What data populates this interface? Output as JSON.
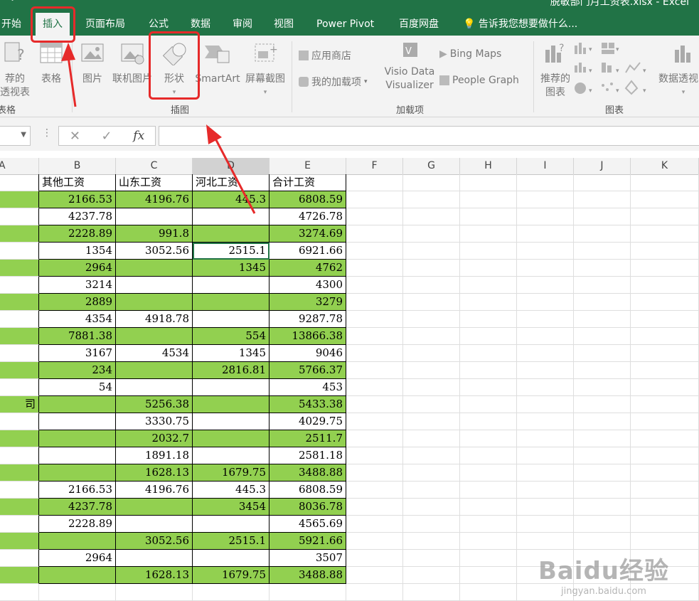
{
  "window": {
    "title": "脱敏部门月工资表.xlsx - Excel"
  },
  "tabs": [
    {
      "label": "开始",
      "active": false
    },
    {
      "label": "插入",
      "active": true
    },
    {
      "label": "页面布局",
      "active": false
    },
    {
      "label": "公式",
      "active": false
    },
    {
      "label": "数据",
      "active": false
    },
    {
      "label": "审阅",
      "active": false
    },
    {
      "label": "视图",
      "active": false
    },
    {
      "label": "Power Pivot",
      "active": false
    },
    {
      "label": "百度网盘",
      "active": false
    }
  ],
  "tell_me": "告诉我您想要做什么...",
  "ribbon": {
    "tables": {
      "pivot_line1": "荐的",
      "pivot_line2": "透视表",
      "table": "表格",
      "group": "表格"
    },
    "illustrations": {
      "picture": "图片",
      "online_picture": "联机图片",
      "shapes": "形状",
      "smartart": "SmartArt",
      "screenshot": "屏幕截图",
      "group": "插图"
    },
    "addins": {
      "store": "应用商店",
      "my_addins": "我的加载项",
      "visio_line1": "Visio Data",
      "visio_line2": "Visualizer",
      "bing": "Bing Maps",
      "people": "People Graph",
      "group": "加载项"
    },
    "charts": {
      "rec_line1": "推荐的",
      "rec_line2": "图表",
      "pivotchart": "数据透视图",
      "group": "图表"
    }
  },
  "formula_bar": {
    "name_box": "",
    "formula": "",
    "cancel_glyph": "✕",
    "enter_glyph": "✓",
    "fx_glyph": "fx"
  },
  "columns": [
    "A",
    "B",
    "C",
    "D",
    "E",
    "F",
    "G",
    "H",
    "I",
    "J",
    "K"
  ],
  "selected_column": "D",
  "header_row": {
    "a": "",
    "b": "其他工资",
    "c": "山东工资",
    "d": "河北工资",
    "e": "合计工资"
  },
  "rows": [
    {
      "a": "",
      "b": "2166.53",
      "c": "4196.76",
      "d": "445.3",
      "e": "6808.59",
      "green": true
    },
    {
      "a": "",
      "b": "4237.78",
      "c": "",
      "d": "",
      "e": "4726.78",
      "green": false
    },
    {
      "a": "",
      "b": "2228.89",
      "c": "991.8",
      "d": "",
      "e": "3274.69",
      "green": true
    },
    {
      "a": "",
      "b": "1354",
      "c": "3052.56",
      "d": "2515.1",
      "e": "6921.66",
      "green": false
    },
    {
      "a": "",
      "b": "2964",
      "c": "",
      "d": "1345",
      "e": "4762",
      "green": true
    },
    {
      "a": "",
      "b": "3214",
      "c": "",
      "d": "",
      "e": "4300",
      "green": false
    },
    {
      "a": "",
      "b": "2889",
      "c": "",
      "d": "",
      "e": "3279",
      "green": true
    },
    {
      "a": "",
      "b": "4354",
      "c": "4918.78",
      "d": "",
      "e": "9287.78",
      "green": false
    },
    {
      "a": "",
      "b": "7881.38",
      "c": "",
      "d": "554",
      "e": "13866.38",
      "green": true
    },
    {
      "a": "",
      "b": "3167",
      "c": "4534",
      "d": "1345",
      "e": "9046",
      "green": false
    },
    {
      "a": "",
      "b": "234",
      "c": "",
      "d": "2816.81",
      "e": "5766.37",
      "green": true
    },
    {
      "a": "",
      "b": "54",
      "c": "",
      "d": "",
      "e": "453",
      "green": false
    },
    {
      "a": "司",
      "b": "",
      "c": "5256.38",
      "d": "",
      "e": "5433.38",
      "green": true
    },
    {
      "a": "",
      "b": "",
      "c": "3330.75",
      "d": "",
      "e": "4029.75",
      "green": false
    },
    {
      "a": "",
      "b": "",
      "c": "2032.7",
      "d": "",
      "e": "2511.7",
      "green": true
    },
    {
      "a": "",
      "b": "",
      "c": "1891.18",
      "d": "",
      "e": "2581.18",
      "green": false
    },
    {
      "a": "",
      "b": "",
      "c": "1628.13",
      "d": "1679.75",
      "e": "3488.88",
      "green": true
    },
    {
      "a": "",
      "b": "2166.53",
      "c": "4196.76",
      "d": "445.3",
      "e": "6808.59",
      "green": false
    },
    {
      "a": "",
      "b": "4237.78",
      "c": "",
      "d": "3454",
      "e": "8036.78",
      "green": true
    },
    {
      "a": "",
      "b": "2228.89",
      "c": "",
      "d": "",
      "e": "4565.69",
      "green": false
    },
    {
      "a": "",
      "b": "",
      "c": "3052.56",
      "d": "2515.1",
      "e": "5921.66",
      "green": true
    },
    {
      "a": "",
      "b": "2964",
      "c": "",
      "d": "",
      "e": "3507",
      "green": false
    },
    {
      "a": "",
      "b": "",
      "c": "1628.13",
      "d": "1679.75",
      "e": "3488.88",
      "green": true
    }
  ],
  "watermark": {
    "main": "Baidu经验",
    "sub": "jingyan.baidu.com"
  },
  "colors": {
    "ribbon_green": "#217346",
    "row_fill": "#92d050",
    "annotation_red": "#e62a2a"
  }
}
